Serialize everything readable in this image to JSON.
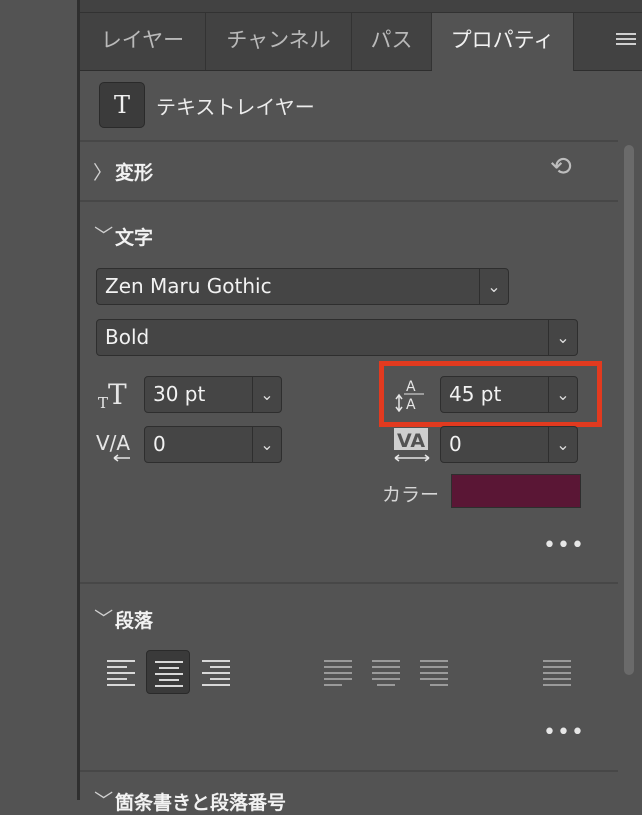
{
  "tabs": [
    {
      "label": "レイヤー"
    },
    {
      "label": "チャンネル"
    },
    {
      "label": "パス"
    },
    {
      "label": "プロパティ"
    }
  ],
  "header": {
    "icon_glyph": "T",
    "label": "テキストレイヤー"
  },
  "sections": {
    "transform": {
      "chevron": "〉",
      "title": "変形",
      "reset_glyph": "⟲"
    },
    "character": {
      "chevron": "〉",
      "title": "文字"
    },
    "paragraph": {
      "chevron": "〉",
      "title": "段落"
    },
    "bullets": {
      "chevron": "〉",
      "title": "箇条書きと段落番号"
    }
  },
  "character": {
    "font_family": "Zen Maru Gothic",
    "font_style": "Bold",
    "font_size": "30 pt",
    "leading": "45 pt",
    "kerning": "0",
    "tracking": "0",
    "color_label": "カラー",
    "color_value": "#5a1635",
    "more": "•••"
  },
  "dropdown_arrow": "⌄",
  "paragraph": {
    "more": "•••"
  }
}
